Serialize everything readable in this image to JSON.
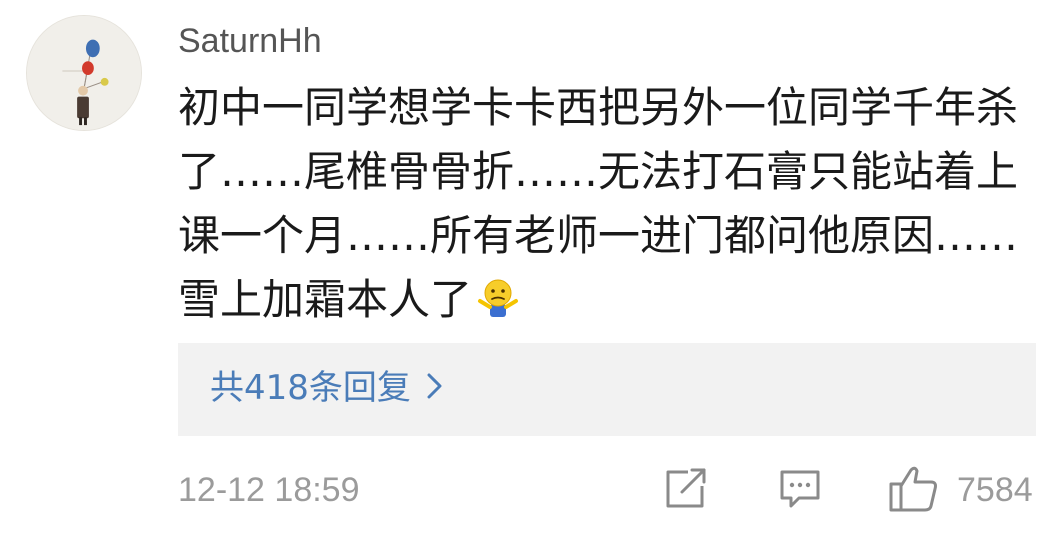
{
  "comment": {
    "username": "SaturnHh",
    "text": "初中一同学想学卡卡西把另外一位同学千年杀了……尾椎骨骨折……无法打石膏只能站着上课一个月……所有老师一进门都问他原因……雪上加霜本人了",
    "emoji_icon": "shrug-emoji",
    "replies_label": "共418条回复",
    "timestamp": "12-12 18:59",
    "like_count": "7584"
  },
  "colors": {
    "link": "#4a7cb8",
    "muted": "#9b9b9b",
    "reply_background": "#f2f2f2"
  }
}
